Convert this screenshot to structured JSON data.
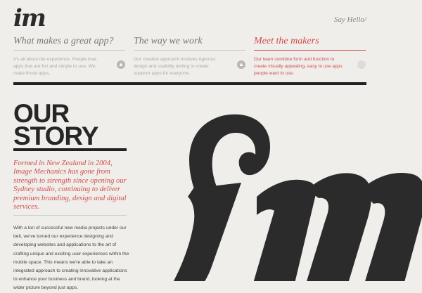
{
  "header": {
    "logo_text": "im",
    "say_hello": "Say Hello/"
  },
  "nav": {
    "items": [
      {
        "title": "What makes a great app?",
        "text": "It's all about the experience. People love apps that are fun and simple to use. We make those apps.",
        "active": false
      },
      {
        "title": "The way we work",
        "text": "Our creative approach involves rigorous design and usability testing to create superior apps for everyone.",
        "active": false
      },
      {
        "title": "Meet the makers",
        "text": "Our team combine form and function to create visually appealing, easy to use apps people want to use.",
        "active": true
      }
    ],
    "button_icon": "arrow-up-icon"
  },
  "main": {
    "heading_line1": "OUR",
    "heading_line2": "STORY",
    "intro": "Formed in New Zealand in 2004, Image Mechanics has gone from strength to strength since opening our Sydney studio, continuing to deliver premium branding, design and digital services.",
    "body": "With a ton of successful new media projects under our belt, we've turned our experience designing and developing websites and applications to the art of crafting unique and exciting user experiences within the mobile space. This means we're able to take an integrated approach to creating innovative applications to enhance your business and brand, looking at the wider picture beyond just apps."
  },
  "colors": {
    "background": "#efeeea",
    "accent": "#d24b4b",
    "dark": "#2b2b2b"
  }
}
